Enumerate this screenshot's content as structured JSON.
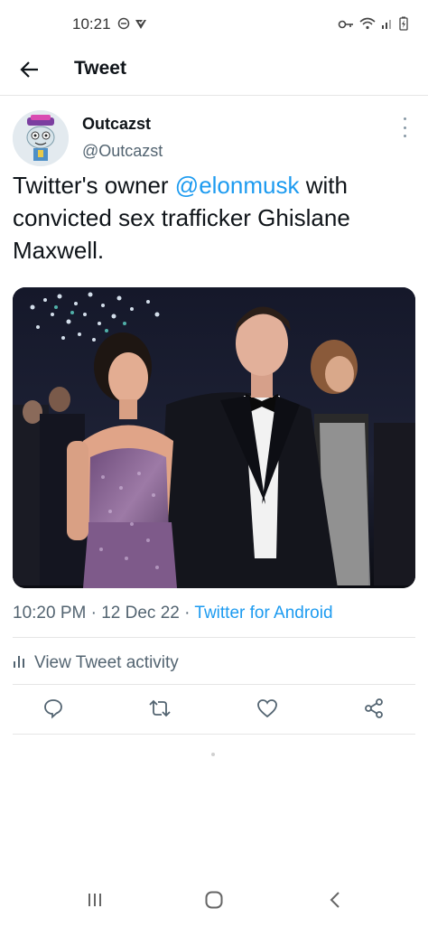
{
  "status_bar": {
    "time": "10:21",
    "left_icons": [
      "do-not-disturb-icon",
      "location-check-icon"
    ],
    "right_icons": [
      "key-icon",
      "wifi-icon",
      "signal-icon",
      "battery-charging-icon"
    ]
  },
  "header": {
    "title": "Tweet",
    "back_icon": "arrow-left-icon"
  },
  "tweet": {
    "author_name": "Outcazst",
    "author_handle": "@Outcazst",
    "text_prefix": "Twitter's owner ",
    "mention": "@elonmusk",
    "text_suffix": " with convicted sex trafficker Ghislane Maxwell.",
    "photo_description_icon": "tweet-photo",
    "time": "10:20 PM",
    "date": "12 Dec 22",
    "separator": "·",
    "source": "Twitter for Android",
    "activity_label": "View Tweet activity"
  },
  "actions": [
    "reply-icon",
    "retweet-icon",
    "like-icon",
    "share-icon"
  ],
  "colors": {
    "accent": "#1d9bf0",
    "text": "#0f1419",
    "secondary": "#536471",
    "divider": "#e6e6e6"
  },
  "nav_bar": [
    "recents-icon",
    "home-icon",
    "back-icon"
  ]
}
